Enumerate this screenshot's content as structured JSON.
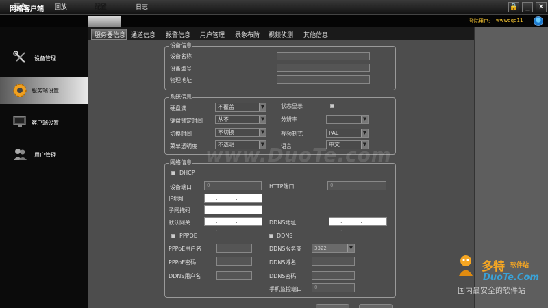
{
  "window": {
    "title": "网络客户端",
    "buttons": {
      "lock": "🔒",
      "minimize": "_",
      "close": "✕"
    }
  },
  "menu": {
    "items": [
      "预览",
      "回放",
      "配置",
      "日志"
    ],
    "active_index": 2,
    "login_label": "登陆用户:",
    "login_user": "wwwqqq11"
  },
  "sidebar": {
    "items": [
      {
        "label": "设备管理",
        "icon": "tools-icon"
      },
      {
        "label": "服务端设置",
        "icon": "server-gear-icon"
      },
      {
        "label": "客户端设置",
        "icon": "monitor-icon"
      },
      {
        "label": "用户管理",
        "icon": "users-icon"
      }
    ],
    "active_index": 1
  },
  "tabs": {
    "items": [
      "服务器信息",
      "通道信息",
      "报警信息",
      "用户管理",
      "录象布防",
      "视频侦测",
      "其他信息"
    ],
    "active_index": 0
  },
  "device_info": {
    "title": "设备信息",
    "name_label": "设备名称",
    "model_label": "设备型号",
    "physical_addr_label": "物理地址"
  },
  "system_info": {
    "title": "系统信息",
    "disk_full_label": "硬盘满",
    "disk_full_value": "不覆盖",
    "disk_lock_label": "键盘锁定时间",
    "disk_lock_value": "从不",
    "switch_time_label": "切换时间",
    "switch_time_value": "不切换",
    "menu_transparency_label": "菜单透明度",
    "menu_transparency_value": "不透明",
    "status_display_label": "状态显示",
    "resolution_label": "分辨率",
    "resolution_value": "",
    "video_format_label": "视频制式",
    "video_format_value": "PAL",
    "language_label": "语言",
    "language_value": "中文"
  },
  "network_info": {
    "title": "网络信息",
    "dhcp_label": "DHCP",
    "device_port_label": "设备端口",
    "device_port_value": "0",
    "http_port_label": "HTTP端口",
    "http_port_value": "0",
    "ip_label": "IP地址",
    "subnet_label": "子网掩码",
    "gateway_label": "默认网关",
    "ddns_addr_label": "DDNS地址",
    "pppoe_label": "PPPOE",
    "ddns_label": "DDNS",
    "pppoe_user_label": "PPPoE用户名",
    "pppoe_pwd_label": "PPPoE密码",
    "ddns_user_label": "DDNS用户名",
    "ddns_server_label": "DDNS服务商",
    "ddns_server_value": "3322",
    "ddns_domain_label": "DDNS域名",
    "ddns_pwd_label": "DDNS密码",
    "mobile_port_label": "手机监控端口",
    "mobile_port_value": "0",
    "ip_dots": ". . ."
  },
  "watermark": {
    "center": "www.DuoTe.com",
    "logo_name": "多特",
    "logo_suffix": "软件站",
    "logo_url": "DuoTe.Com",
    "slogan": "国内最安全的软件站"
  }
}
